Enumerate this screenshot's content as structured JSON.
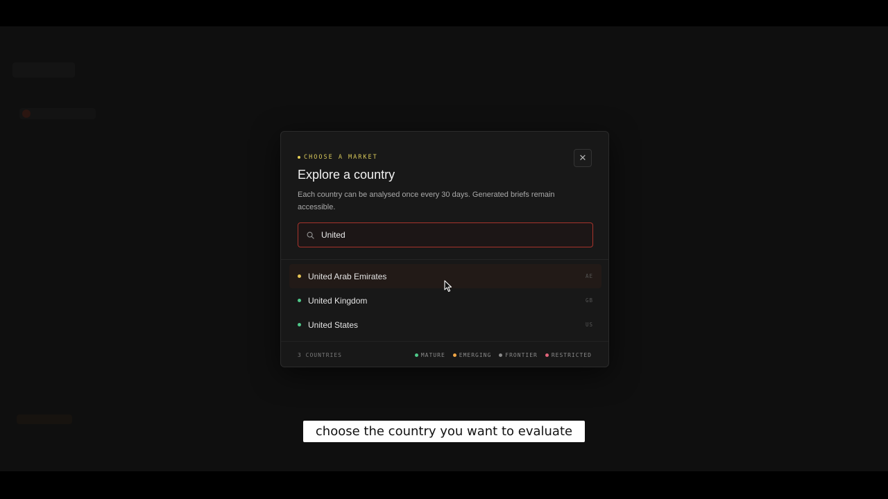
{
  "modal": {
    "eyebrow": "CHOOSE A MARKET",
    "title": "Explore a country",
    "description": "Each country can be analysed once every 30 days. Generated briefs remain accessible.",
    "close_icon": "close-icon",
    "search": {
      "value": "United",
      "icon": "search-icon"
    },
    "results": [
      {
        "name": "United Arab Emirates",
        "code": "AE",
        "status": "emerging",
        "dot_color": "#e6c455",
        "highlighted": true
      },
      {
        "name": "United Kingdom",
        "code": "GB",
        "status": "mature",
        "dot_color": "#4fc98a",
        "highlighted": false
      },
      {
        "name": "United States",
        "code": "US",
        "status": "mature",
        "dot_color": "#4fc98a",
        "highlighted": false
      }
    ],
    "footer": {
      "count": "3 COUNTRIES",
      "legend": [
        {
          "label": "MATURE",
          "color": "#4fc98a"
        },
        {
          "label": "EMERGING",
          "color": "#f0a545"
        },
        {
          "label": "FRONTIER",
          "color": "#8a8a8a"
        },
        {
          "label": "RESTRICTED",
          "color": "#e0647a"
        }
      ]
    }
  },
  "caption": "choose the country you want to evaluate",
  "colors": {
    "accent": "#a8342c",
    "background": "#0f0f0f",
    "modal_bg": "#181818"
  }
}
